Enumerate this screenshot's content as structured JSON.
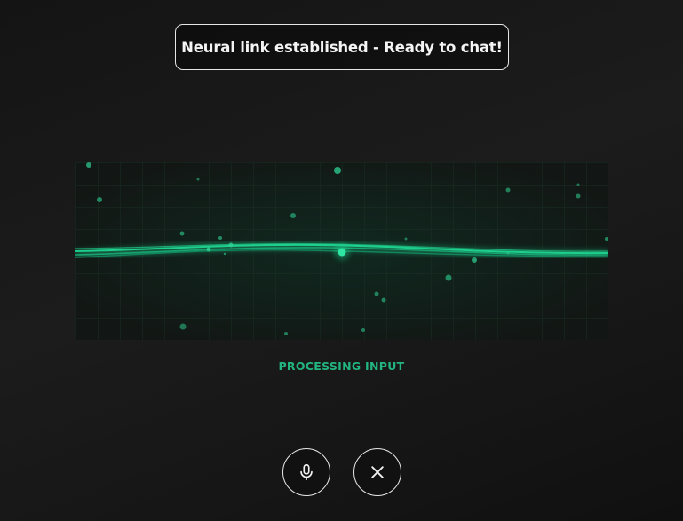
{
  "toast": {
    "message": "Neural link established - Ready to chat!"
  },
  "visualizer": {
    "accent_color": "#1fd590",
    "grid_color": "#1e3a2e"
  },
  "status": {
    "label": "PROCESSING INPUT",
    "color": "#22b57f"
  },
  "controls": {
    "mic_icon": "microphone-icon",
    "close_icon": "close-icon"
  }
}
